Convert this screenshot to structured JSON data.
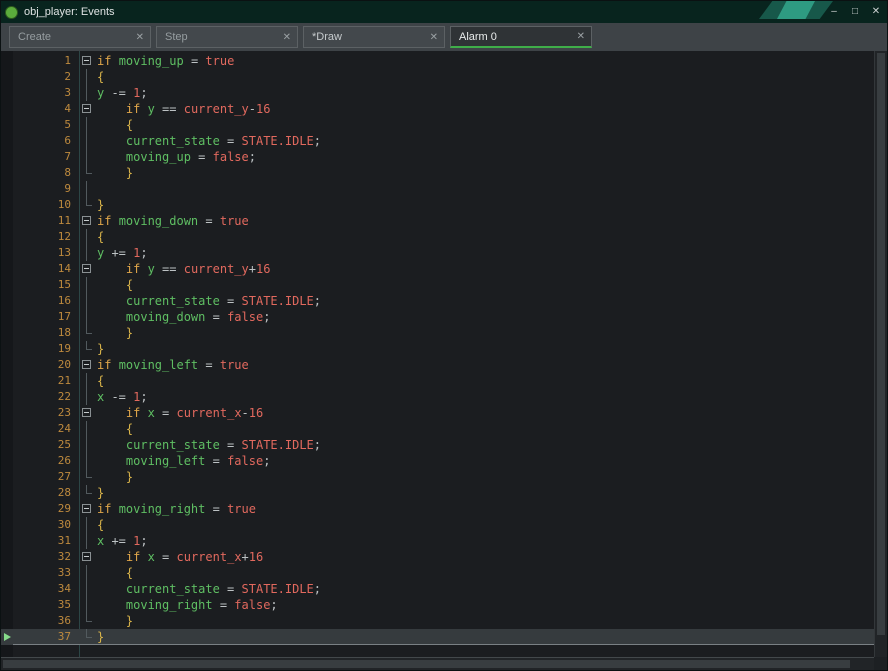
{
  "window": {
    "title": "obj_player: Events"
  },
  "icons": {
    "minimize": "–",
    "maximize": "□",
    "close_window": "✕",
    "close_tab": "✕",
    "current_line_marker": "▶",
    "app_logo": "gamemaker-logo"
  },
  "colors": {
    "accent_green": "#3FAE49",
    "titlebar_teal": "#08241E",
    "decoration_teal": "#2E9B82",
    "keyword": "#DFA64A",
    "variable": "#5FBF63",
    "constant": "#E2695E",
    "operator": "#BDC2C4",
    "brace": "#D9B44A",
    "line_number": "#BE8A3E",
    "plain": "#C8CCCE"
  },
  "tabs": [
    {
      "label": "Create",
      "active": false,
      "modified": false
    },
    {
      "label": "Step",
      "active": false,
      "modified": false
    },
    {
      "label": "*Draw",
      "active": false,
      "modified": true
    },
    {
      "label": "Alarm 0",
      "active": true,
      "modified": false
    }
  ],
  "editor": {
    "current_line": 37,
    "lines": [
      {
        "n": 1,
        "f": "box",
        "t": [
          [
            "k",
            "if"
          ],
          [
            "p",
            " "
          ],
          [
            "v",
            "moving_up"
          ],
          [
            "o",
            " = "
          ],
          [
            "c",
            "true"
          ]
        ]
      },
      {
        "n": 2,
        "f": "line",
        "t": [
          [
            "b",
            "{"
          ]
        ]
      },
      {
        "n": 3,
        "f": "line",
        "t": [
          [
            "v",
            "y"
          ],
          [
            "o",
            " -= "
          ],
          [
            "c",
            "1"
          ],
          [
            "o",
            ";"
          ]
        ]
      },
      {
        "n": 4,
        "f": "box",
        "t": [
          [
            "p",
            "    "
          ],
          [
            "k",
            "if"
          ],
          [
            "p",
            " "
          ],
          [
            "v",
            "y"
          ],
          [
            "o",
            " == "
          ],
          [
            "c",
            "current_y"
          ],
          [
            "o",
            "-"
          ],
          [
            "c",
            "16"
          ]
        ]
      },
      {
        "n": 5,
        "f": "line",
        "t": [
          [
            "p",
            "    "
          ],
          [
            "b",
            "{"
          ]
        ]
      },
      {
        "n": 6,
        "f": "line",
        "t": [
          [
            "p",
            "    "
          ],
          [
            "v",
            "current_state"
          ],
          [
            "o",
            " = "
          ],
          [
            "c",
            "STATE.IDLE"
          ],
          [
            "o",
            ";"
          ]
        ]
      },
      {
        "n": 7,
        "f": "line",
        "t": [
          [
            "p",
            "    "
          ],
          [
            "v",
            "moving_up"
          ],
          [
            "o",
            " = "
          ],
          [
            "c",
            "false"
          ],
          [
            "o",
            ";"
          ]
        ]
      },
      {
        "n": 8,
        "f": "end",
        "t": [
          [
            "p",
            "    "
          ],
          [
            "b",
            "}"
          ]
        ]
      },
      {
        "n": 9,
        "f": "line",
        "t": []
      },
      {
        "n": 10,
        "f": "end",
        "t": [
          [
            "b",
            "}"
          ]
        ]
      },
      {
        "n": 11,
        "f": "box",
        "t": [
          [
            "k",
            "if"
          ],
          [
            "p",
            " "
          ],
          [
            "v",
            "moving_down"
          ],
          [
            "o",
            " = "
          ],
          [
            "c",
            "true"
          ]
        ]
      },
      {
        "n": 12,
        "f": "line",
        "t": [
          [
            "b",
            "{"
          ]
        ]
      },
      {
        "n": 13,
        "f": "line",
        "t": [
          [
            "v",
            "y"
          ],
          [
            "o",
            " += "
          ],
          [
            "c",
            "1"
          ],
          [
            "o",
            ";"
          ]
        ]
      },
      {
        "n": 14,
        "f": "box",
        "t": [
          [
            "p",
            "    "
          ],
          [
            "k",
            "if"
          ],
          [
            "p",
            " "
          ],
          [
            "v",
            "y"
          ],
          [
            "o",
            " == "
          ],
          [
            "c",
            "current_y"
          ],
          [
            "o",
            "+"
          ],
          [
            "c",
            "16"
          ]
        ]
      },
      {
        "n": 15,
        "f": "line",
        "t": [
          [
            "p",
            "    "
          ],
          [
            "b",
            "{"
          ]
        ]
      },
      {
        "n": 16,
        "f": "line",
        "t": [
          [
            "p",
            "    "
          ],
          [
            "v",
            "current_state"
          ],
          [
            "o",
            " = "
          ],
          [
            "c",
            "STATE.IDLE"
          ],
          [
            "o",
            ";"
          ]
        ]
      },
      {
        "n": 17,
        "f": "line",
        "t": [
          [
            "p",
            "    "
          ],
          [
            "v",
            "moving_down"
          ],
          [
            "o",
            " = "
          ],
          [
            "c",
            "false"
          ],
          [
            "o",
            ";"
          ]
        ]
      },
      {
        "n": 18,
        "f": "end",
        "t": [
          [
            "p",
            "    "
          ],
          [
            "b",
            "}"
          ]
        ]
      },
      {
        "n": 19,
        "f": "end",
        "t": [
          [
            "b",
            "}"
          ]
        ]
      },
      {
        "n": 20,
        "f": "box",
        "t": [
          [
            "k",
            "if"
          ],
          [
            "p",
            " "
          ],
          [
            "v",
            "moving_left"
          ],
          [
            "o",
            " = "
          ],
          [
            "c",
            "true"
          ]
        ]
      },
      {
        "n": 21,
        "f": "line",
        "t": [
          [
            "b",
            "{"
          ]
        ]
      },
      {
        "n": 22,
        "f": "line",
        "t": [
          [
            "v",
            "x"
          ],
          [
            "o",
            " -= "
          ],
          [
            "c",
            "1"
          ],
          [
            "o",
            ";"
          ]
        ]
      },
      {
        "n": 23,
        "f": "box",
        "t": [
          [
            "p",
            "    "
          ],
          [
            "k",
            "if"
          ],
          [
            "p",
            " "
          ],
          [
            "v",
            "x"
          ],
          [
            "o",
            " = "
          ],
          [
            "c",
            "current_x"
          ],
          [
            "o",
            "-"
          ],
          [
            "c",
            "16"
          ]
        ]
      },
      {
        "n": 24,
        "f": "line",
        "t": [
          [
            "p",
            "    "
          ],
          [
            "b",
            "{"
          ]
        ]
      },
      {
        "n": 25,
        "f": "line",
        "t": [
          [
            "p",
            "    "
          ],
          [
            "v",
            "current_state"
          ],
          [
            "o",
            " = "
          ],
          [
            "c",
            "STATE.IDLE"
          ],
          [
            "o",
            ";"
          ]
        ]
      },
      {
        "n": 26,
        "f": "line",
        "t": [
          [
            "p",
            "    "
          ],
          [
            "v",
            "moving_left"
          ],
          [
            "o",
            " = "
          ],
          [
            "c",
            "false"
          ],
          [
            "o",
            ";"
          ]
        ]
      },
      {
        "n": 27,
        "f": "end",
        "t": [
          [
            "p",
            "    "
          ],
          [
            "b",
            "}"
          ]
        ]
      },
      {
        "n": 28,
        "f": "end",
        "t": [
          [
            "b",
            "}"
          ]
        ]
      },
      {
        "n": 29,
        "f": "box",
        "t": [
          [
            "k",
            "if"
          ],
          [
            "p",
            " "
          ],
          [
            "v",
            "moving_right"
          ],
          [
            "o",
            " = "
          ],
          [
            "c",
            "true"
          ]
        ]
      },
      {
        "n": 30,
        "f": "line",
        "t": [
          [
            "b",
            "{"
          ]
        ]
      },
      {
        "n": 31,
        "f": "line",
        "t": [
          [
            "v",
            "x"
          ],
          [
            "o",
            " += "
          ],
          [
            "c",
            "1"
          ],
          [
            "o",
            ";"
          ]
        ]
      },
      {
        "n": 32,
        "f": "box",
        "t": [
          [
            "p",
            "    "
          ],
          [
            "k",
            "if"
          ],
          [
            "p",
            " "
          ],
          [
            "v",
            "x"
          ],
          [
            "o",
            " = "
          ],
          [
            "c",
            "current_x"
          ],
          [
            "o",
            "+"
          ],
          [
            "c",
            "16"
          ]
        ]
      },
      {
        "n": 33,
        "f": "line",
        "t": [
          [
            "p",
            "    "
          ],
          [
            "b",
            "{"
          ]
        ]
      },
      {
        "n": 34,
        "f": "line",
        "t": [
          [
            "p",
            "    "
          ],
          [
            "v",
            "current_state"
          ],
          [
            "o",
            " = "
          ],
          [
            "c",
            "STATE.IDLE"
          ],
          [
            "o",
            ";"
          ]
        ]
      },
      {
        "n": 35,
        "f": "line",
        "t": [
          [
            "p",
            "    "
          ],
          [
            "v",
            "moving_right"
          ],
          [
            "o",
            " = "
          ],
          [
            "c",
            "false"
          ],
          [
            "o",
            ";"
          ]
        ]
      },
      {
        "n": 36,
        "f": "end",
        "t": [
          [
            "p",
            "    "
          ],
          [
            "b",
            "}"
          ]
        ]
      },
      {
        "n": 37,
        "f": "end",
        "t": [
          [
            "b",
            "}"
          ]
        ]
      }
    ]
  }
}
